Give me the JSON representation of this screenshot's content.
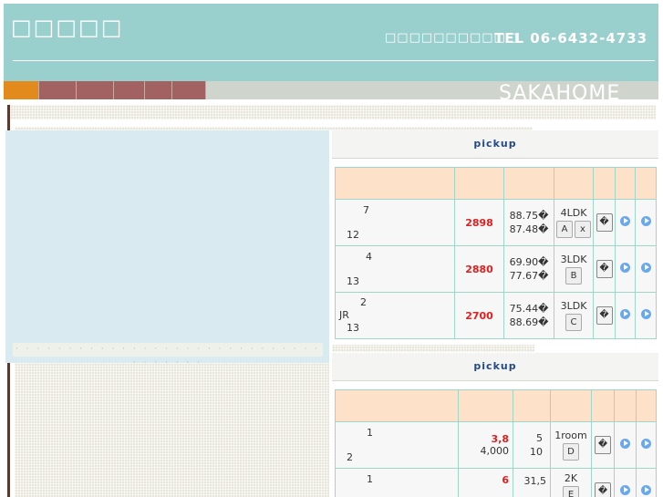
{
  "header": {
    "title": "□□□□□",
    "caption": "□□□□□□□□□□□",
    "tel": "TEL 06-6432-4733"
  },
  "nav": {
    "brand": "SAKAHOME",
    "tab_colors": [
      "#e28a1c",
      "#a36262",
      "#a36262",
      "#a36262",
      "#a36262",
      "#a36262"
    ]
  },
  "left_panel": {
    "bar_text": "· · · · · · · · · · · · · · · · · · · · · · · · · · · · · · · · · · · ·"
  },
  "pickup_sections": [
    {
      "title": "pickup",
      "rows": [
        {
          "addr_top": "7",
          "addr_mid": "",
          "addr_bottom": "12",
          "price": "2898",
          "area1": "88.75�",
          "area2": "87.48�",
          "layout": "4LDK",
          "buttons": [
            "A",
            "x"
          ],
          "detail": "�"
        },
        {
          "addr_top": "4",
          "addr_mid": "",
          "addr_bottom": "13",
          "price": "2880",
          "area1": "69.90�",
          "area2": "77.67�",
          "layout": "3LDK",
          "buttons": [
            "B"
          ],
          "detail": "�"
        },
        {
          "addr_top": "2",
          "addr_mid": "JR",
          "addr_bottom": "13",
          "price": "2700",
          "area1": "75.44�",
          "area2": "88.69�",
          "layout": "3LDK",
          "buttons": [
            "C"
          ],
          "detail": "�"
        }
      ]
    },
    {
      "title": "pickup",
      "rows": [
        {
          "addr_top": "1",
          "addr_mid": "",
          "addr_bottom": "2",
          "price": "3,8",
          "price2": "4,000",
          "area1": "5",
          "area2": "10",
          "layout": "1room",
          "buttons": [
            "D"
          ],
          "detail": "�"
        },
        {
          "addr_top": "1",
          "addr_mid": "",
          "addr_bottom": "",
          "price": "6",
          "price2": "",
          "area1": "31,5",
          "area2": "",
          "layout": "2K",
          "buttons": [
            "E"
          ],
          "detail": "�"
        }
      ]
    }
  ]
}
